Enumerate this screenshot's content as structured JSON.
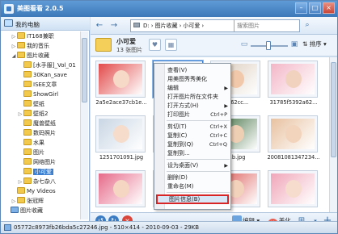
{
  "window": {
    "title": "美图看看 2.0.5",
    "buttons": {
      "minimize": "–",
      "maximize": "□",
      "close": "×"
    }
  },
  "sidebar": {
    "header": "我的电脑",
    "tree": [
      {
        "label": "IT168兼职",
        "level": 1,
        "icon": "folder",
        "expander": "▷"
      },
      {
        "label": "我的音乐",
        "level": 1,
        "icon": "folder",
        "expander": "▷"
      },
      {
        "label": "图片收藏",
        "level": 1,
        "icon": "folder",
        "expander": "◢"
      },
      {
        "label": "[水手服]_Vol_01",
        "level": 2,
        "icon": "folder",
        "expander": ""
      },
      {
        "label": "30Kan_save",
        "level": 2,
        "icon": "folder",
        "expander": ""
      },
      {
        "label": "ISEE文章",
        "level": 2,
        "icon": "folder",
        "expander": ""
      },
      {
        "label": "ShowGirl",
        "level": 2,
        "icon": "folder",
        "expander": ""
      },
      {
        "label": "壁纸",
        "level": 2,
        "icon": "folder",
        "expander": ""
      },
      {
        "label": "壁纸2",
        "level": 2,
        "icon": "folder",
        "expander": "▷"
      },
      {
        "label": "魔兽壁纸",
        "level": 2,
        "icon": "folder",
        "expander": ""
      },
      {
        "label": "数码照片",
        "level": 2,
        "icon": "folder",
        "expander": ""
      },
      {
        "label": "水果",
        "level": 2,
        "icon": "folder",
        "expander": ""
      },
      {
        "label": "图片",
        "level": 2,
        "icon": "folder",
        "expander": ""
      },
      {
        "label": "网络图片",
        "level": 2,
        "icon": "folder",
        "expander": ""
      },
      {
        "label": "小可爱",
        "level": 2,
        "icon": "folder",
        "expander": "",
        "selected": true
      },
      {
        "label": "杂七杂八",
        "level": 2,
        "icon": "folder",
        "expander": "▷"
      },
      {
        "label": "My Videos",
        "level": 1,
        "icon": "folder",
        "expander": ""
      },
      {
        "label": "张冠辉",
        "level": 1,
        "icon": "folder",
        "expander": "▷"
      },
      {
        "label": "图片收藏",
        "level": 0,
        "icon": "drive",
        "expander": ""
      }
    ]
  },
  "toolbar": {
    "back": "←",
    "forward": "→",
    "address": [
      "D:",
      "图片收藏",
      "小可爱"
    ],
    "address_sep": "›",
    "search_placeholder": "搜索图片",
    "search_icon": "⌕"
  },
  "folder_header": {
    "name": "小可爱",
    "count": "13 张图片",
    "heart": "♥",
    "share": "▦",
    "zoom_out": "▭",
    "zoom_in": "▣",
    "zoom_level": 0.48,
    "sort_label": "排序"
  },
  "thumbnails": [
    {
      "caption": "2a5e2ace37cb1e...",
      "palette": [
        "#e24b4b",
        "#f6d9c6"
      ]
    },
    {
      "caption": "05",
      "palette": [
        "#6ea9e6",
        "#f3d8c4"
      ],
      "selected": true
    },
    {
      "caption": "9462cc...",
      "palette": [
        "#d9c9b8",
        "#f1c9aa"
      ]
    },
    {
      "caption": "31785f5392a62...",
      "palette": [
        "#f3b6c7",
        "#f0d2bf"
      ]
    },
    {
      "caption": "1251701091.jpg",
      "palette": [
        "#c9d6e4",
        "#f5dccb"
      ]
    },
    {
      "caption": "",
      "palette": [
        "#eadfd2",
        "#f3d4bd"
      ]
    },
    {
      "caption": "...b.jpg",
      "palette": [
        "#3c6b3c",
        "#efcfb4"
      ]
    },
    {
      "caption": "20081081347234...",
      "palette": [
        "#e8c1a0",
        "#f2d3bc"
      ]
    },
    {
      "caption": "",
      "palette": [
        "#e66b8a",
        "#f4d6c2"
      ]
    },
    {
      "caption": "",
      "palette": [
        "#7bb0e2",
        "#f2d6c0"
      ]
    },
    {
      "caption": "",
      "palette": [
        "#d9534f",
        "#f2d2bb"
      ]
    },
    {
      "caption": "",
      "palette": [
        "#f0a6b9",
        "#f5dccc"
      ]
    }
  ],
  "context_menu": [
    {
      "label": "查看(V)",
      "shortcut": "",
      "arrow": false
    },
    {
      "label": "用美图秀秀美化",
      "shortcut": "",
      "arrow": false
    },
    {
      "label": "编辑",
      "shortcut": "",
      "arrow": true
    },
    {
      "label": "打开图片所在文件夹",
      "shortcut": "",
      "arrow": false
    },
    {
      "label": "打开方式(H)",
      "shortcut": "",
      "arrow": true
    },
    {
      "label": "打印图片",
      "shortcut": "Ctrl+P",
      "arrow": false
    },
    {
      "separator": true
    },
    {
      "label": "剪切(T)",
      "shortcut": "Ctrl+X",
      "arrow": false
    },
    {
      "label": "复制(C)",
      "shortcut": "Ctrl+C",
      "arrow": false
    },
    {
      "label": "复制到(Q)",
      "shortcut": "Ctrl+Q",
      "arrow": false
    },
    {
      "label": "复制到...",
      "shortcut": "",
      "arrow": false
    },
    {
      "separator": true
    },
    {
      "label": "设为桌面(V)",
      "shortcut": "",
      "arrow": true
    },
    {
      "separator": true
    },
    {
      "label": "删除(D)",
      "shortcut": "",
      "arrow": false
    },
    {
      "label": "重命名(M)",
      "shortcut": "",
      "arrow": false
    },
    {
      "separator": true
    },
    {
      "label": "图片信息(B)",
      "shortcut": "",
      "arrow": false,
      "highlighted": true
    }
  ],
  "bottom_toolbar": {
    "rotate_left": "↺",
    "rotate_right": "↻",
    "delete": "×",
    "edit_label": "编辑",
    "beautify_label": "美化",
    "beautify_icon_text": "美",
    "arrow": "▾",
    "fit": "⊞",
    "add": "+"
  },
  "status": {
    "text": "05772c8973fb26bda5c27246.jpg - 510×414 - 2010-09-03 - 29KB"
  }
}
